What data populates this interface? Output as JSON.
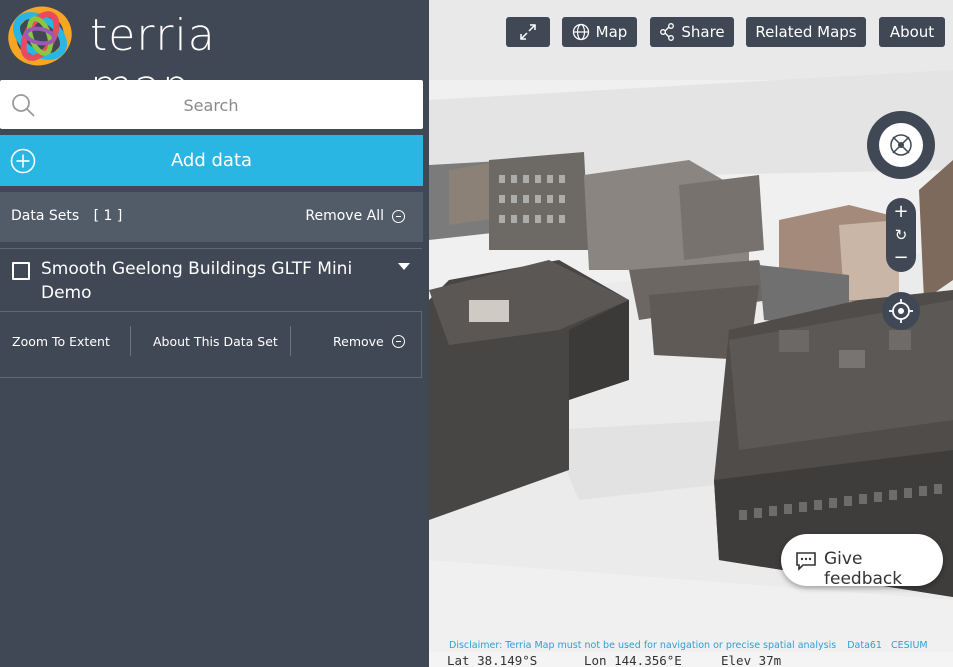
{
  "app": {
    "logo_text": "terria map"
  },
  "search": {
    "placeholder": "Search"
  },
  "add_data": {
    "label": "Add data"
  },
  "datasets": {
    "title": "Data Sets",
    "count": "[ 1 ]",
    "remove_all_label": "Remove All",
    "items": [
      {
        "title": "Smooth Geelong Buildings GLTF Mini Demo",
        "actions": {
          "zoom": "Zoom To Extent",
          "about": "About This Data Set",
          "remove": "Remove"
        }
      }
    ]
  },
  "map_toolbar": {
    "fullscreen_icon": "expand-icon",
    "map_label": "Map",
    "share_label": "Share",
    "related_maps_label": "Related Maps",
    "about_label": "About"
  },
  "map_controls": {
    "zoom_in": "+",
    "reset": "↻",
    "zoom_out": "−"
  },
  "feedback": {
    "label": "Give feedback"
  },
  "footer": {
    "disclaimer": "Disclaimer: Terria Map must not be used for navigation or precise spatial analysis",
    "data61": "Data61",
    "cesium": "CESIUM",
    "lat": "Lat  38.149°S",
    "lon": "Lon  144.356°E",
    "elev": "Elev  37m"
  },
  "colors": {
    "sidebar": "#3f4854",
    "accent": "#29b6e2",
    "panel": "#525c69"
  }
}
